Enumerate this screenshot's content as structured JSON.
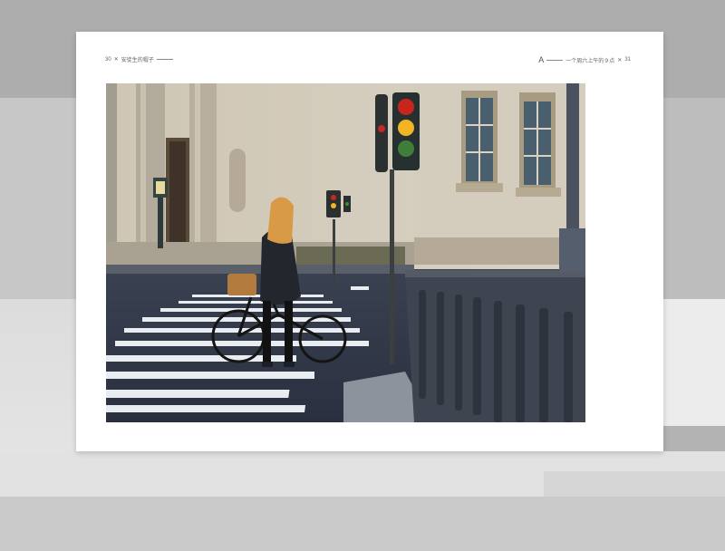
{
  "book": {
    "left_page_number": "30",
    "left_running_title": "安徒生的帽子",
    "right_section_mark": "A",
    "right_running_title": "一个周六上午的９点",
    "right_page_number": "31",
    "separator": "✕"
  },
  "photo": {
    "subject": "woman-with-bicycle-at-crosswalk"
  },
  "colors": {
    "page": "#ffffff",
    "background": "#b3b3b3"
  }
}
